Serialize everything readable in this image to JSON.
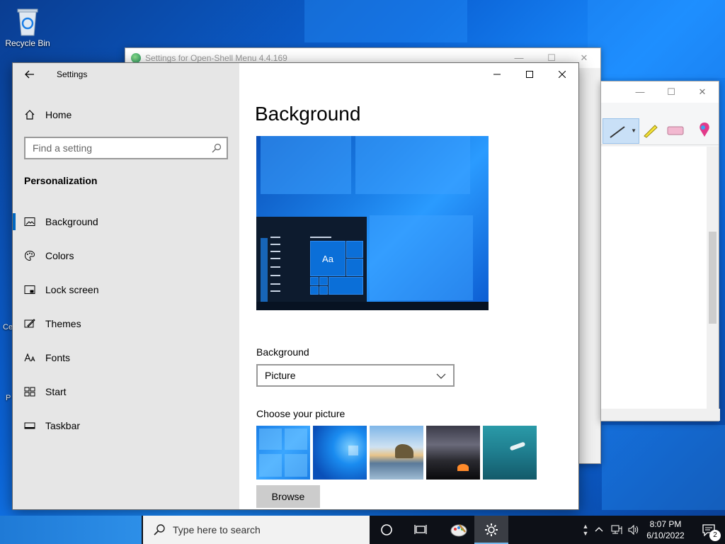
{
  "desktop": {
    "recycle_bin_label": "Recycle Bin",
    "fragment_1": "Ce",
    "fragment_2": "P"
  },
  "back_window": {
    "title": "Settings for Open-Shell Menu 4.4.169",
    "minimize": "—",
    "maximize": "☐",
    "close": "✕"
  },
  "paint_window": {
    "minimize": "—",
    "maximize": "☐",
    "close": "✕"
  },
  "settings": {
    "app_title": "Settings",
    "home_label": "Home",
    "search_placeholder": "Find a setting",
    "section_title": "Personalization",
    "nav_items": [
      {
        "label": "Background",
        "icon": "picture-icon",
        "active": true
      },
      {
        "label": "Colors",
        "icon": "palette-icon",
        "active": false
      },
      {
        "label": "Lock screen",
        "icon": "lock-screen-icon",
        "active": false
      },
      {
        "label": "Themes",
        "icon": "themes-icon",
        "active": false
      },
      {
        "label": "Fonts",
        "icon": "fonts-icon",
        "active": false
      },
      {
        "label": "Start",
        "icon": "start-icon",
        "active": false
      },
      {
        "label": "Taskbar",
        "icon": "taskbar-icon",
        "active": false
      }
    ],
    "page_title": "Background",
    "preview_tile_text": "Aa",
    "background_label": "Background",
    "background_value": "Picture",
    "choose_label": "Choose your picture",
    "browse_label": "Browse"
  },
  "taskbar": {
    "search_placeholder": "Type here to search",
    "time": "8:07 PM",
    "date": "6/10/2022",
    "notification_count": "2"
  },
  "colors": {
    "accent": "#0067c0",
    "nav_bg": "#e6e6e6",
    "taskbar_bg": "#0d1017"
  }
}
